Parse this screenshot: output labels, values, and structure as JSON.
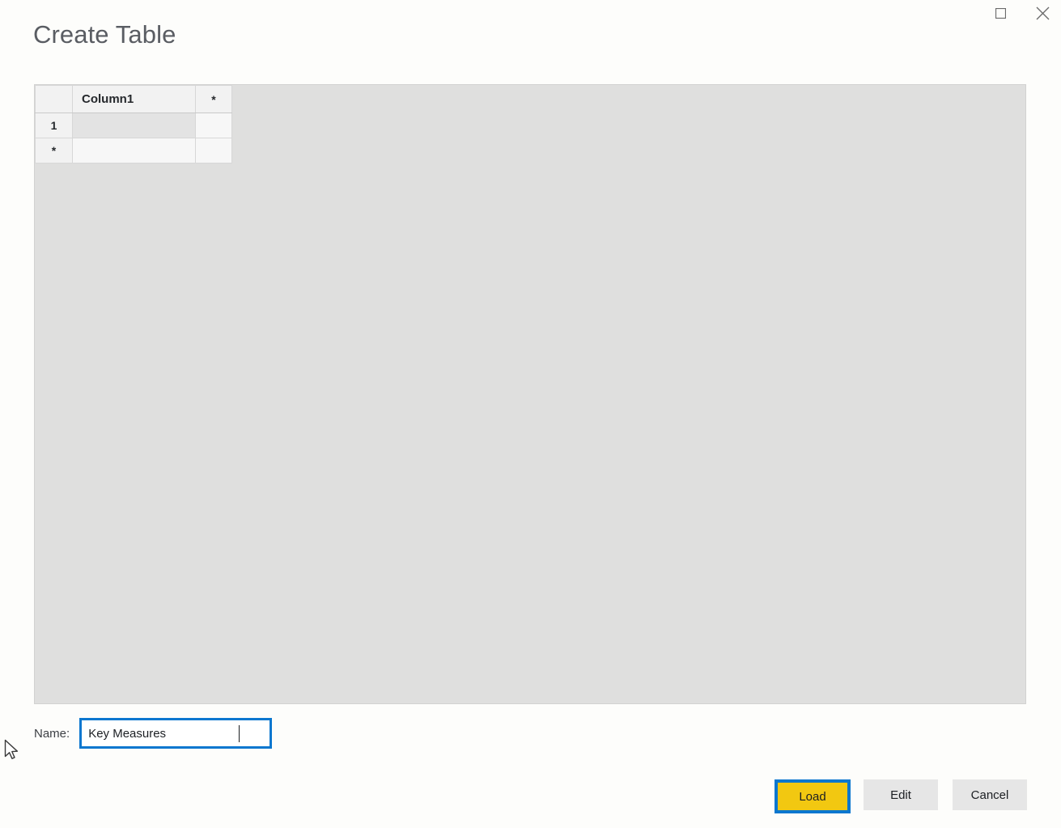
{
  "window": {
    "controls": [
      {
        "name": "maximize",
        "glyph": "square",
        "tooltip": "Maximize"
      },
      {
        "name": "close",
        "glyph": "x",
        "tooltip": "Close"
      }
    ]
  },
  "dialog": {
    "title": "Create Table"
  },
  "grid": {
    "columns": [
      {
        "id": "rowheader",
        "label": ""
      },
      {
        "id": "column1",
        "label": "Column1"
      },
      {
        "id": "newcolumn",
        "label": "*"
      }
    ],
    "rows": [
      {
        "header": "1",
        "cells": [
          ""
        ],
        "selected": true
      },
      {
        "header": "*",
        "cells": [
          ""
        ],
        "selected": false
      }
    ]
  },
  "name_field": {
    "label": "Name:",
    "value": "Key Measures",
    "placeholder": ""
  },
  "footer": {
    "buttons": [
      {
        "id": "load",
        "label": "Load",
        "primary": true,
        "focused": true
      },
      {
        "id": "edit",
        "label": "Edit",
        "primary": false,
        "focused": false
      },
      {
        "id": "cancel",
        "label": "Cancel",
        "primary": false,
        "focused": false
      }
    ]
  },
  "colors": {
    "page_background": "#fdfdfb",
    "panel_background": "#dfdfde",
    "focus_blue": "#0b77cf",
    "load_yellow": "#f2c811",
    "secondary_button": "#e6e6e6",
    "title_text": "#5a5d63"
  }
}
